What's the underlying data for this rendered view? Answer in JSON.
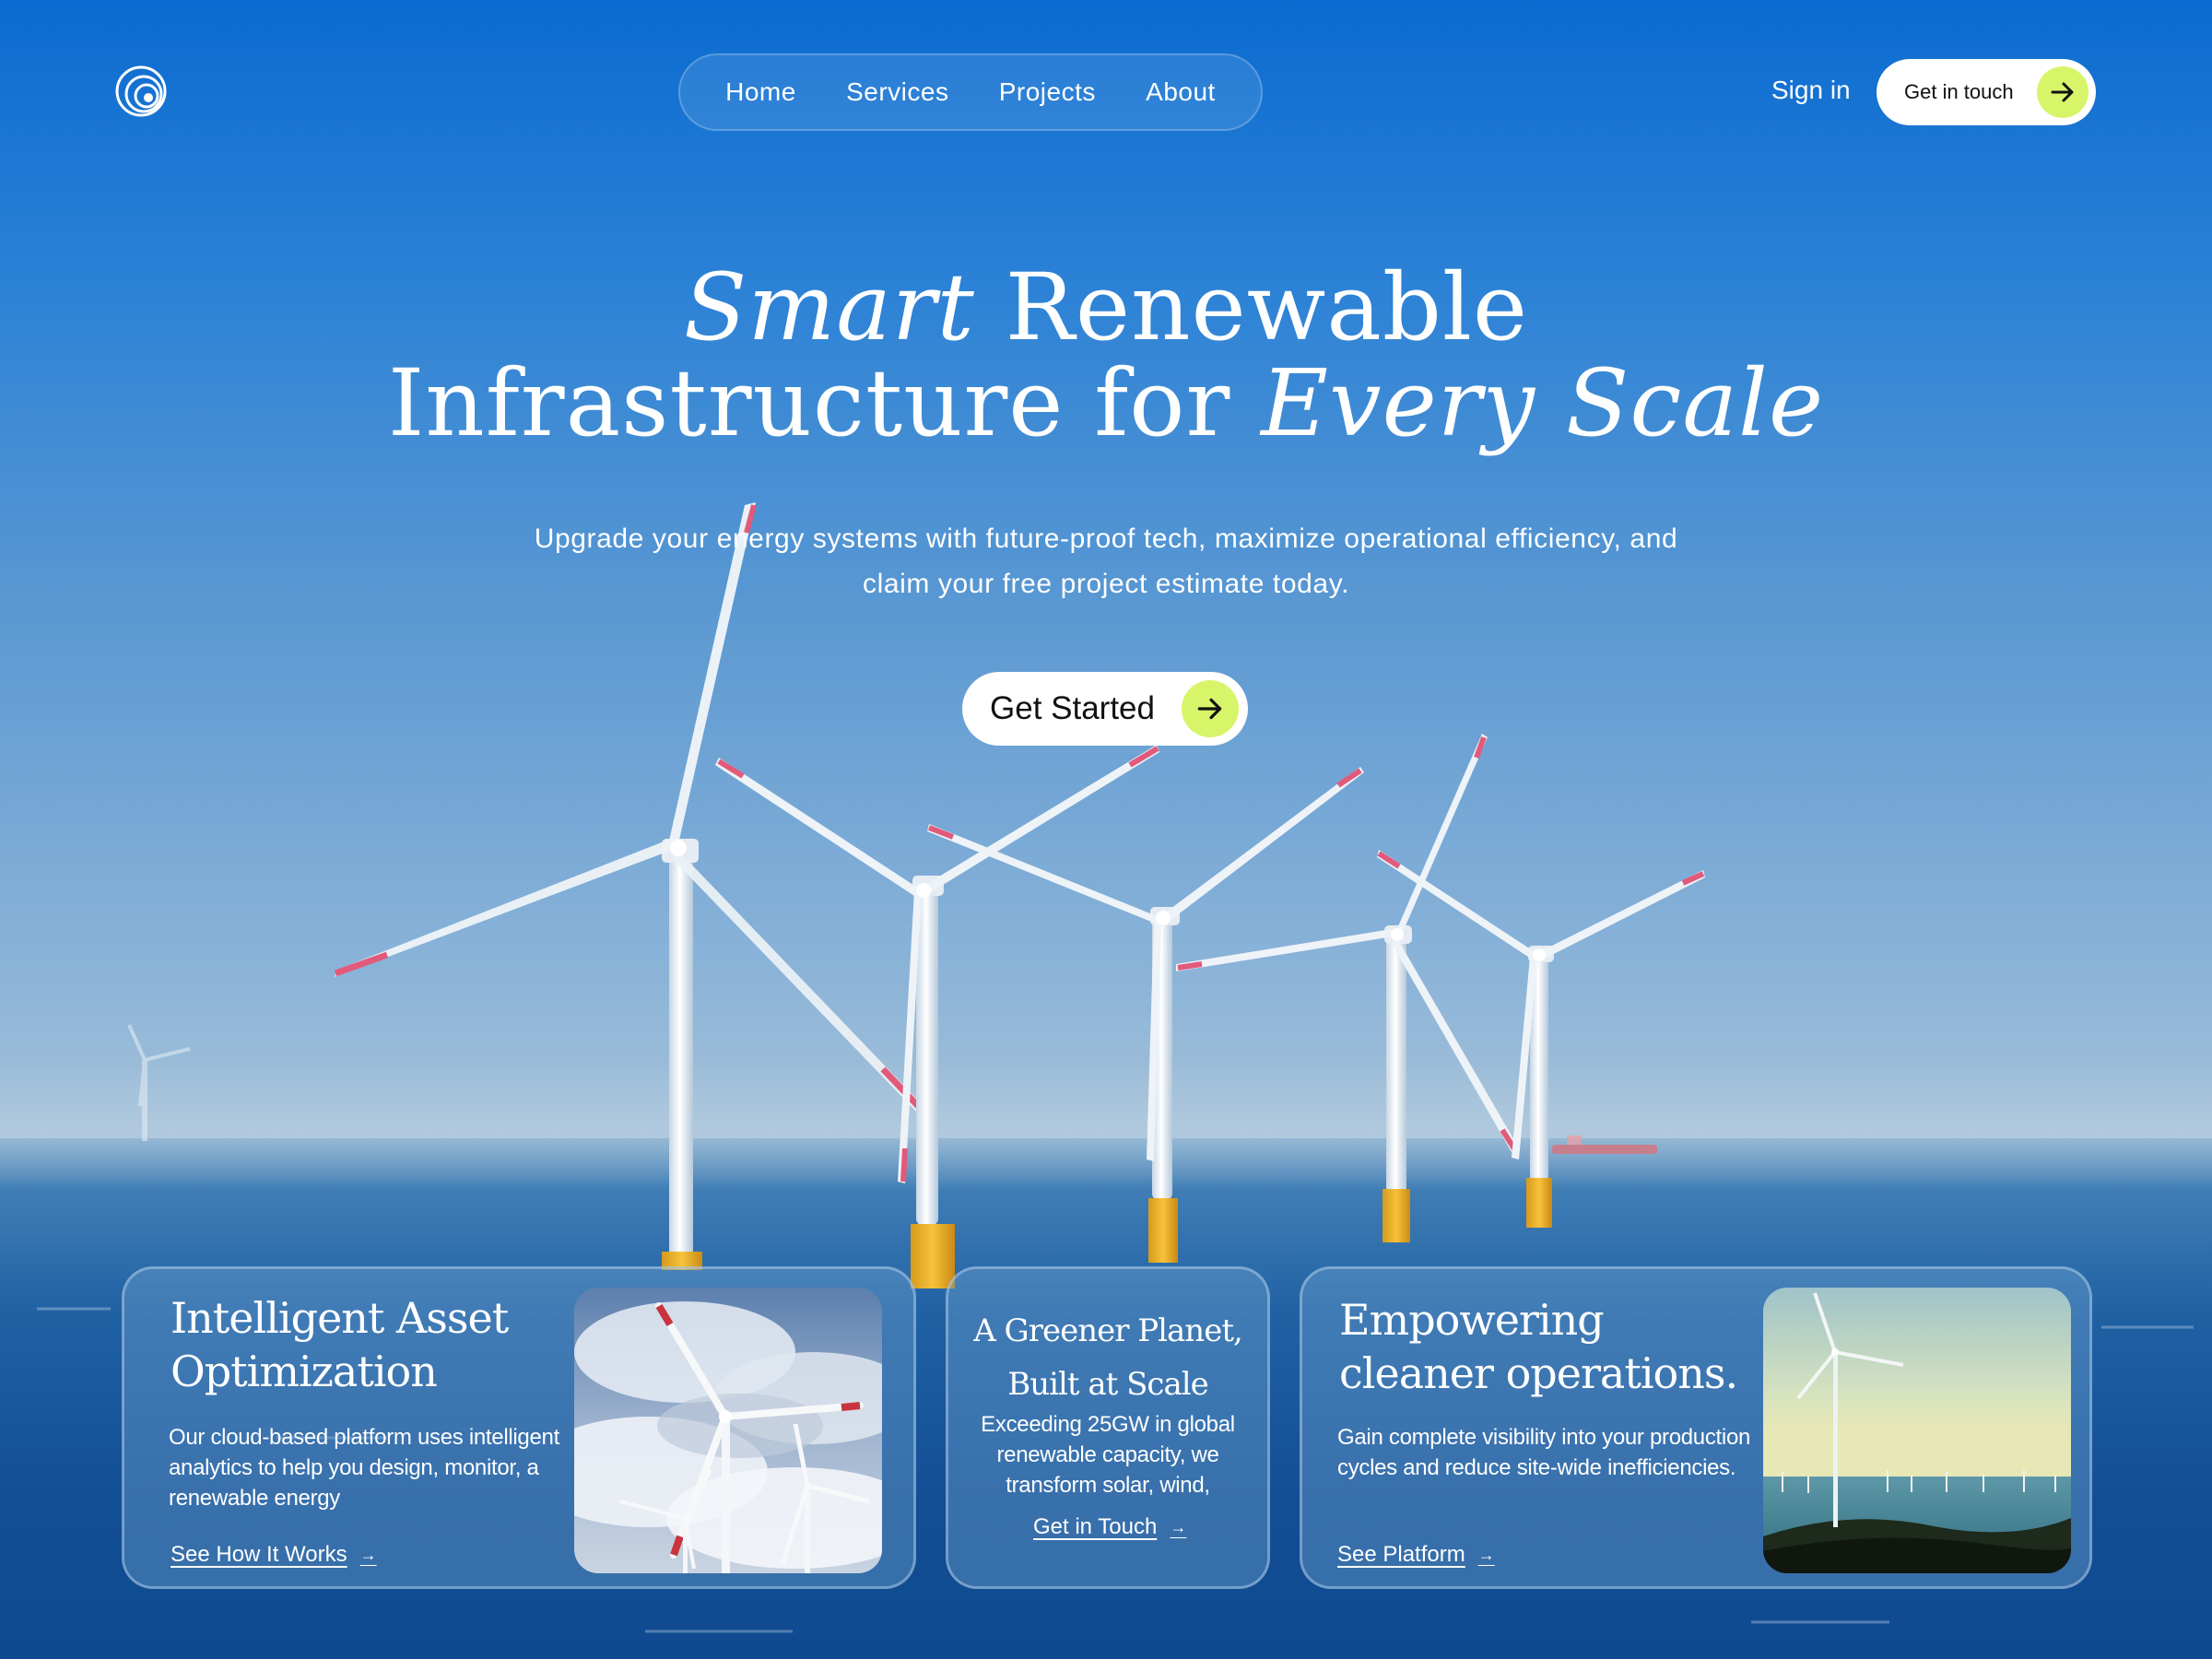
{
  "nav": {
    "logo": "concentric-rings-logo",
    "links": [
      "Home",
      "Services",
      "Projects",
      "About"
    ],
    "sign_in": "Sign in",
    "cta": "Get in touch"
  },
  "hero": {
    "title_part1_italic": "Smart",
    "title_part1": " Renewable",
    "title_part2": "Infrastructure for ",
    "title_part2_italic": "Every Scale",
    "subtitle": "Upgrade your energy systems with future-proof tech, maximize operational efficiency, and claim your free project estimate today.",
    "cta": "Get Started"
  },
  "cards": {
    "optimization": {
      "title": "Intelligent Asset Optimization",
      "text": "Our cloud-based platform uses intelligent analytics to help you design, monitor, a renewable energy",
      "link": "See How It Works"
    },
    "planet": {
      "title": "A Greener Planet, Built at Scale",
      "text": "Exceeding 25GW in global renewable capacity, we transform solar, wind,",
      "link": "Get in Touch"
    },
    "operations": {
      "title": "Empowering cleaner operations.",
      "text": "Gain complete visibility into your production cycles and reduce site-wide inefficiencies.",
      "link": "See Platform"
    }
  },
  "colors": {
    "accent": "#d8f56a",
    "sky": "#0b6bd0",
    "sea": "#124e94",
    "white": "#ffffff"
  }
}
